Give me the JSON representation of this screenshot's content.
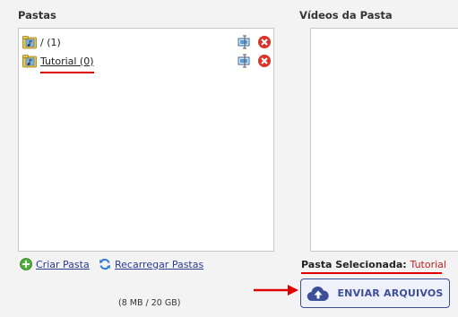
{
  "folders_panel": {
    "title": "Pastas",
    "items": [
      {
        "label": "/ (1)"
      },
      {
        "label": "Tutorial (0)"
      }
    ]
  },
  "videos_panel": {
    "title": "Vídeos da Pasta"
  },
  "actions": {
    "create_folder": "Criar Pasta",
    "reload_folders": "Recarregar Pastas"
  },
  "storage": "(8 MB / 20 GB)",
  "selected_folder": {
    "label": "Pasta Selecionada:",
    "value": "Tutorial"
  },
  "send_button": {
    "label": "ENVIAR ARQUIVOS"
  },
  "colors": {
    "accent": "#3d4f99",
    "highlight_red": "#e00000",
    "delete_red": "#d9342b"
  },
  "icons": {
    "folder": "music-folder-icon",
    "edit": "monitor-edit-icon",
    "delete": "delete-icon",
    "create": "plus-icon",
    "reload": "reload-icon",
    "upload": "cloud-upload-icon",
    "arrow": "arrow-right-icon"
  }
}
